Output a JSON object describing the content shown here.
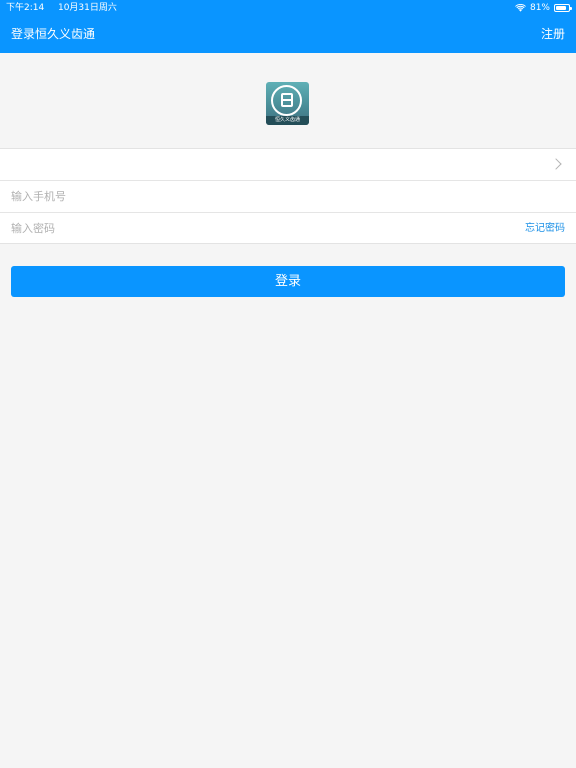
{
  "status_bar": {
    "time": "下午2:14",
    "date": "10月31日周六",
    "battery_text": "81%",
    "battery_level": 0.81
  },
  "nav": {
    "title": "登录恒久义齿通",
    "register_label": "注册"
  },
  "logo": {
    "caption": "恒久义齿通"
  },
  "form": {
    "selector_value": "",
    "phone_placeholder": "输入手机号",
    "password_placeholder": "输入密码",
    "forgot_label": "忘记密码"
  },
  "login_button_label": "登录",
  "colors": {
    "primary": "#0a95ff",
    "link": "#1a8fe6",
    "background": "#f5f5f5"
  }
}
